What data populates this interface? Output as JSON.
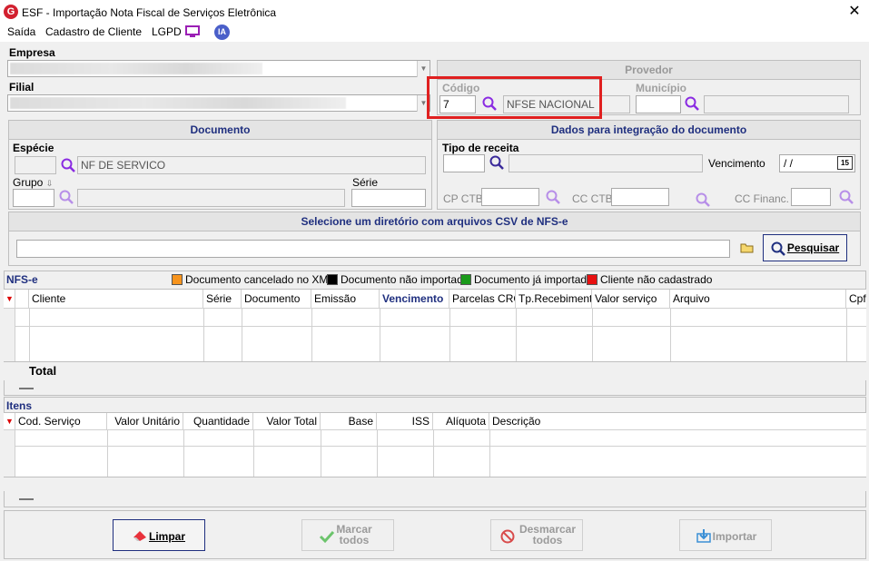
{
  "window": {
    "title": "ESF - Importação Nota Fiscal de Serviços Eletrônica",
    "logo_letter": "G",
    "close": "✕"
  },
  "menu": {
    "items": [
      "Saída",
      "Cadastro de Cliente",
      "LGPD"
    ],
    "ia_label": "IA"
  },
  "empresa": {
    "label": "Empresa"
  },
  "filial": {
    "label": "Filial"
  },
  "provedor": {
    "header": "Provedor",
    "codigo_label": "Código",
    "codigo_value": "7",
    "provedor_name": "NFSE NACIONAL",
    "municipio_label": "Município"
  },
  "documento": {
    "header": "Documento",
    "especie_label": "Espécie",
    "especie_value": "NF DE SERVICO",
    "grupo_label": "Grupo",
    "serie_label": "Série"
  },
  "integracao": {
    "header": "Dados para integração do documento",
    "tipo_receita_label": "Tipo de receita",
    "vencimento_label": "Vencimento",
    "vencimento_value": " / /",
    "cal_label": "15",
    "cp_ctb_label": "CP CTB",
    "cc_ctb_label": "CC CTB",
    "cc_financ_label": "CC Financ."
  },
  "diretorio": {
    "header": "Selecione um diretório com arquivos CSV de NFS-e",
    "pesquisar_label": "Pesquisar"
  },
  "nfse": {
    "title": "NFS-e",
    "legend": [
      {
        "label": "Documento cancelado no XML",
        "color": "#f7941d"
      },
      {
        "label": "Documento não importado",
        "color": "#000000"
      },
      {
        "label": "Documento já importado",
        "color": "#1a9a1a"
      },
      {
        "label": "Cliente não cadastrado",
        "color": "#e81010"
      }
    ],
    "columns": [
      "Cliente",
      "Série",
      "Documento",
      "Emissão",
      "Vencimento",
      "Parcelas CRC",
      "Tp.Recebimento",
      "Valor serviço",
      "Arquivo",
      "Cpf."
    ],
    "total_label": "Total"
  },
  "itens": {
    "title": "Itens",
    "columns": [
      "Cod. Serviço",
      "Valor Unitário",
      "Quantidade",
      "Valor Total",
      "Base",
      "ISS",
      "Alíquota",
      "Descrição"
    ]
  },
  "buttons": {
    "limpar": "Limpar",
    "marcar": [
      "Marcar",
      "todos"
    ],
    "desmarcar": [
      "Desmarcar",
      "todos"
    ],
    "importar": "Importar"
  }
}
